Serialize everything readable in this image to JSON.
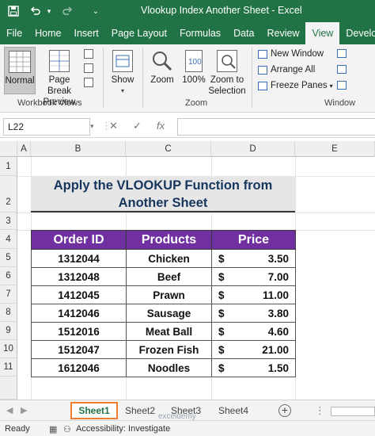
{
  "titlebar": {
    "title": "Vlookup Index Another Sheet  -  Excel",
    "save_icon": "save-icon",
    "undo_icon": "undo-icon",
    "redo_icon": "redo-icon",
    "customize_icon": "customize-quick-access-icon"
  },
  "tabs": [
    "File",
    "Home",
    "Insert",
    "Page Layout",
    "Formulas",
    "Data",
    "Review",
    "View",
    "Developer"
  ],
  "active_tab": "View",
  "ribbon": {
    "workbook_views": {
      "normal": "Normal",
      "page_break_1": "Page Break",
      "page_break_2": "Preview",
      "group": "Workbook Views"
    },
    "show": {
      "label": "Show"
    },
    "zoom": {
      "zoom": "Zoom",
      "zoom100": "100%",
      "zoom_sel_1": "Zoom to",
      "zoom_sel_2": "Selection",
      "group": "Zoom"
    },
    "window": {
      "new_window": "New Window",
      "arrange_all": "Arrange All",
      "freeze_panes": "Freeze Panes",
      "group": "Window"
    }
  },
  "formula_bar": {
    "name_box": "L22",
    "cancel": "✕",
    "enter": "✓",
    "fx": "fx",
    "value": ""
  },
  "grid": {
    "columns": [
      "A",
      "B",
      "C",
      "D",
      "E"
    ],
    "rows": [
      "1",
      "2",
      "3",
      "4",
      "5",
      "6",
      "7",
      "8",
      "9",
      "10",
      "11"
    ],
    "title_line1": "Apply the VLOOKUP Function from",
    "title_line2": "Another Sheet",
    "headers": [
      "Order ID",
      "Products",
      "Price"
    ],
    "rows_data": [
      {
        "id": "1312044",
        "product": "Chicken",
        "currency": "$",
        "price": "3.50"
      },
      {
        "id": "1312048",
        "product": "Beef",
        "currency": "$",
        "price": "7.00"
      },
      {
        "id": "1412045",
        "product": "Prawn",
        "currency": "$",
        "price": "11.00"
      },
      {
        "id": "1412046",
        "product": "Sausage",
        "currency": "$",
        "price": "3.80"
      },
      {
        "id": "1512016",
        "product": "Meat Ball",
        "currency": "$",
        "price": "4.60"
      },
      {
        "id": "1512047",
        "product": "Frozen Fish",
        "currency": "$",
        "price": "21.00"
      },
      {
        "id": "1612046",
        "product": "Noodles",
        "currency": "$",
        "price": "1.50"
      }
    ]
  },
  "sheets": {
    "tabs": [
      "Sheet1",
      "Sheet2",
      "Sheet3",
      "Sheet4"
    ],
    "active": "Sheet1",
    "add": "+"
  },
  "status": {
    "ready": "Ready",
    "accessibility": "Accessibility: Investigate"
  },
  "watermark": "exceldemy",
  "colors": {
    "excel_green": "#217346",
    "header_purple": "#7030a0",
    "title_text": "#17365d",
    "active_tab_outline": "#ed7d31"
  }
}
